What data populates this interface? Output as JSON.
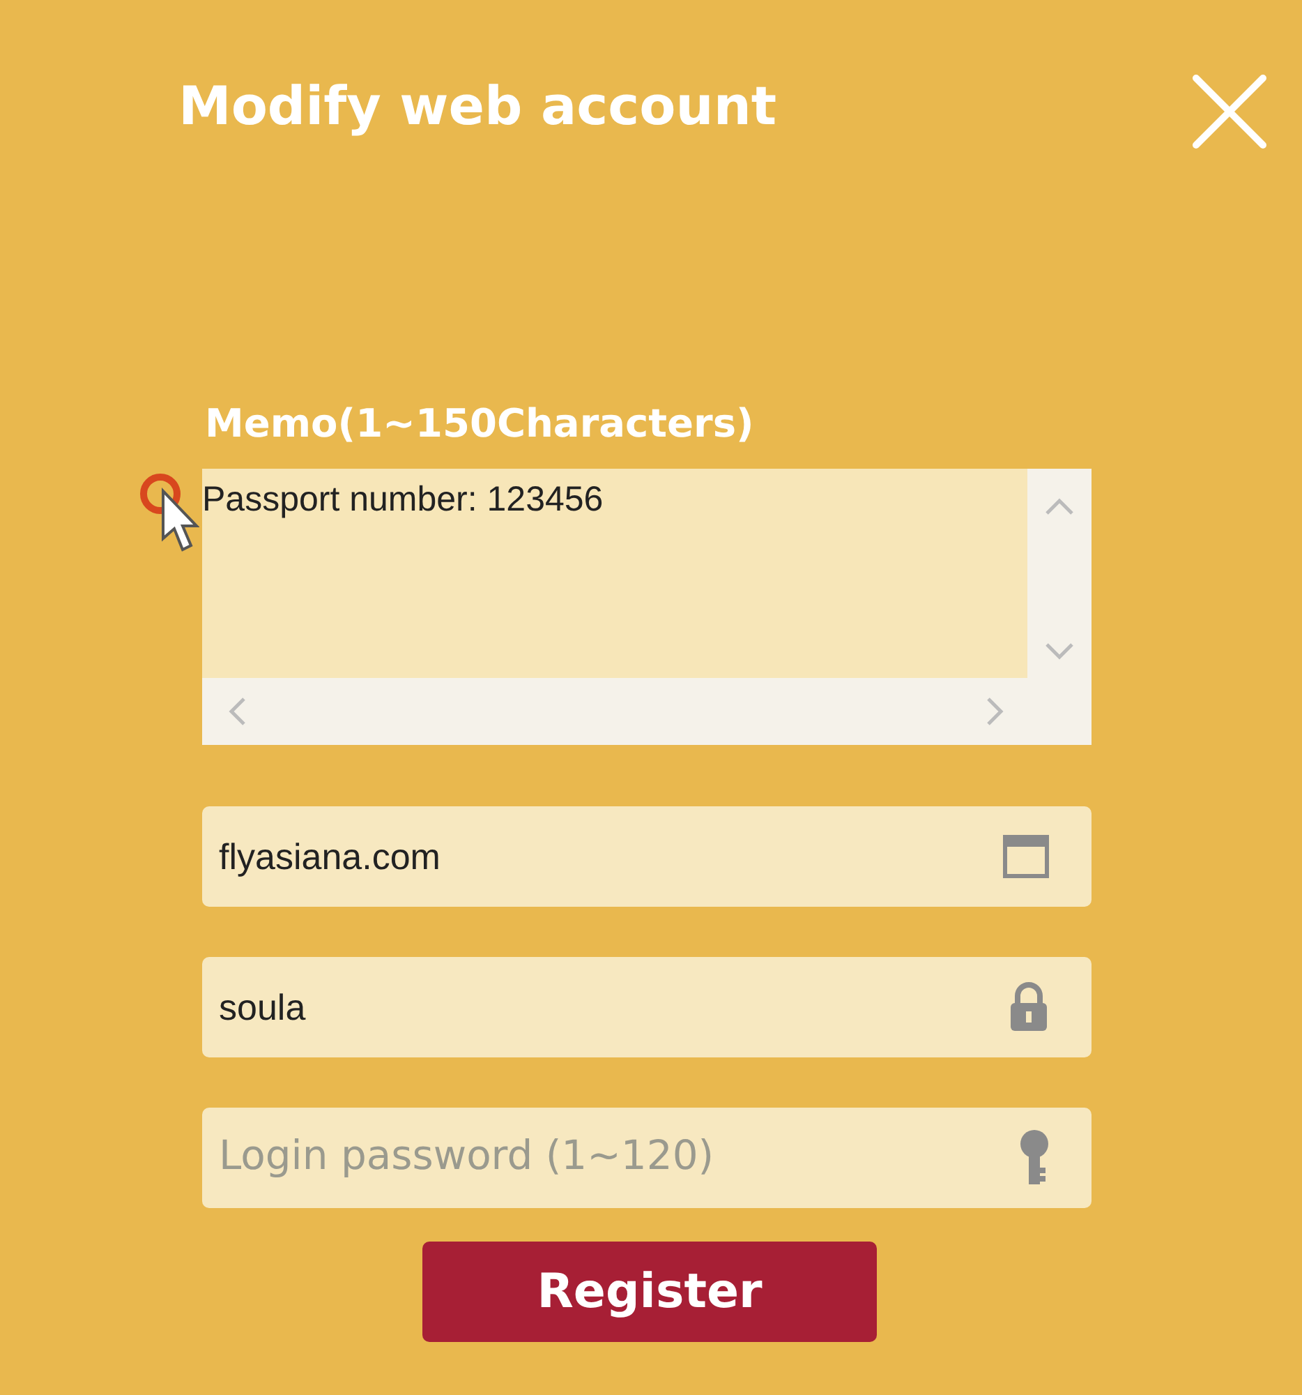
{
  "dialog": {
    "title": "Modify web account"
  },
  "memo": {
    "label": "Memo(1~150Characters)",
    "value": "Passport number: 123456"
  },
  "fields": [
    {
      "kind": "site",
      "value": "flyasiana.com"
    },
    {
      "kind": "user",
      "value": "soula"
    },
    {
      "kind": "password",
      "placeholder": "Login password (1~120)"
    }
  ],
  "buttons": [
    {
      "label": "Register"
    }
  ]
}
